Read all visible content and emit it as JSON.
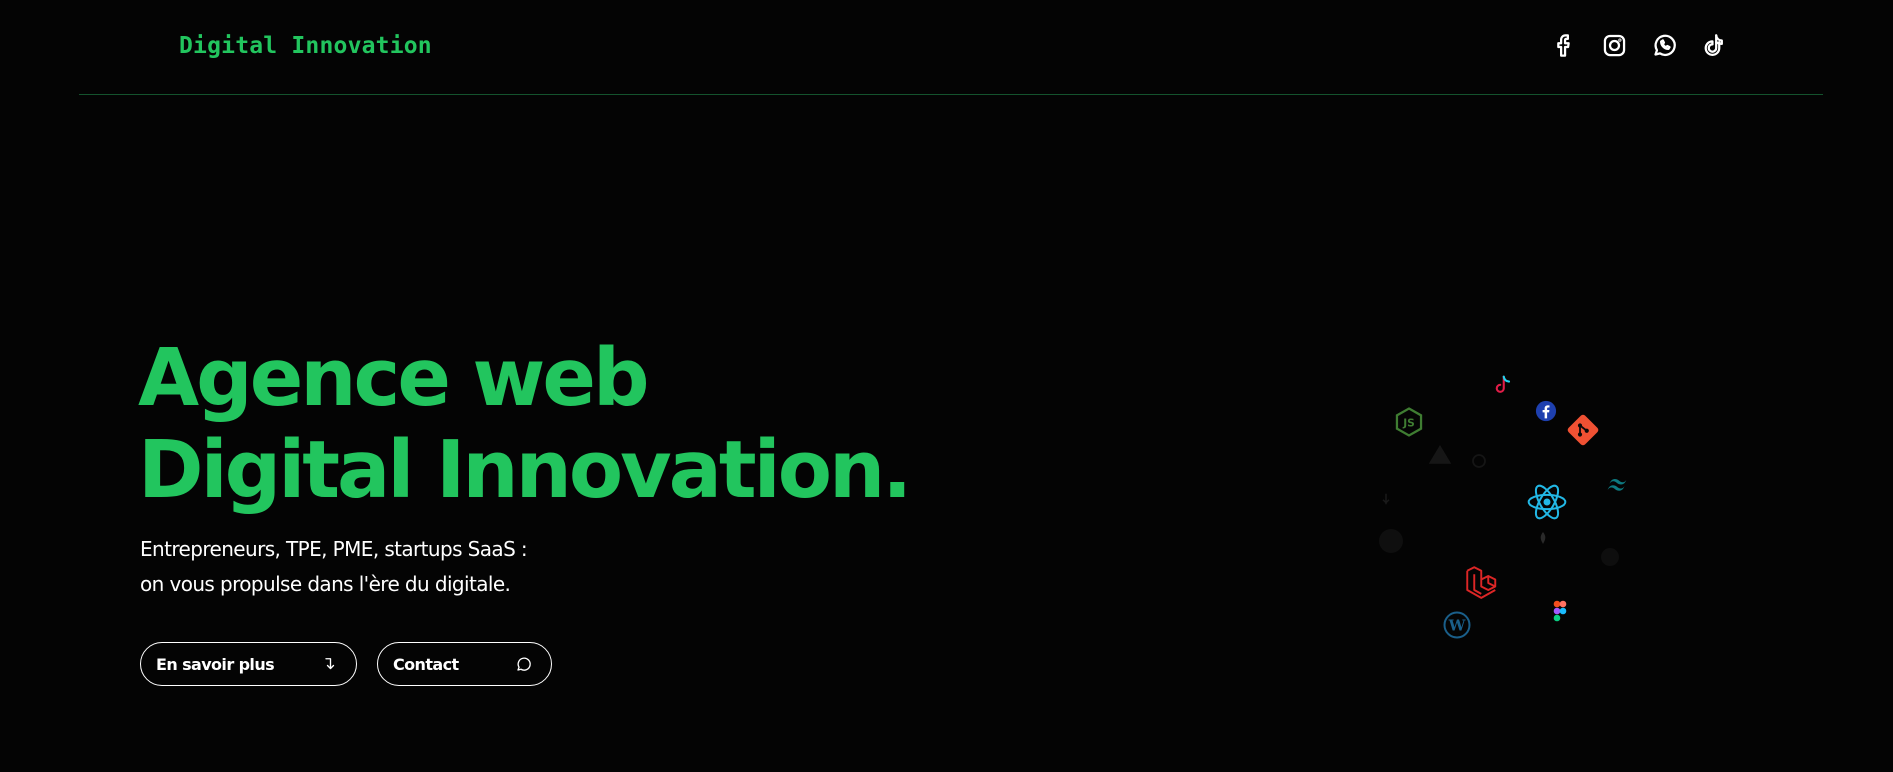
{
  "header": {
    "logo": "Digital Innovation",
    "social": [
      {
        "name": "facebook-icon"
      },
      {
        "name": "instagram-icon"
      },
      {
        "name": "whatsapp-icon"
      },
      {
        "name": "tiktok-icon"
      }
    ]
  },
  "hero": {
    "title_line1": "Agence web",
    "title_line2": "Digital Innovation.",
    "subtitle_line1": "Entrepreneurs, TPE, PME, startups SaaS :",
    "subtitle_line2": "on vous propulse dans l'ère du digitale.",
    "btn_more": "En savoir plus",
    "btn_contact": "Contact"
  },
  "tech_cloud": {
    "icons": [
      "tiktok-icon",
      "facebook-icon",
      "git-icon",
      "nodejs-icon",
      "vercel-icon",
      "github-icon",
      "react-icon",
      "tailwind-icon",
      "android-icon",
      "mysql-icon",
      "php-icon",
      "nextjs-icon",
      "laravel-icon",
      "figma-icon",
      "wordpress-icon"
    ]
  },
  "colors": {
    "accent": "#22c55e",
    "background": "#040404",
    "divider": "#14532d",
    "text": "#ffffff"
  }
}
